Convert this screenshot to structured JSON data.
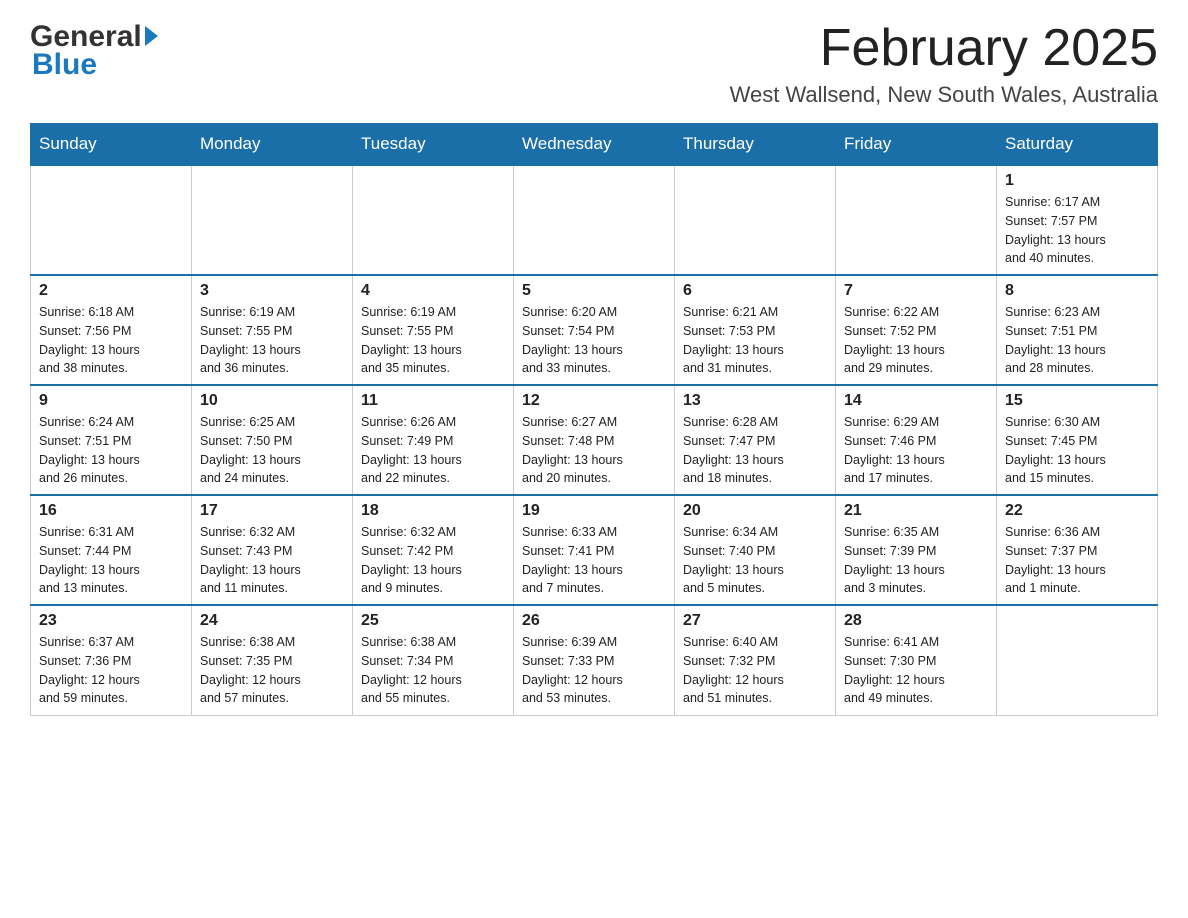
{
  "logo": {
    "general": "General",
    "blue": "Blue",
    "arrow": "▶"
  },
  "header": {
    "title": "February 2025",
    "subtitle": "West Wallsend, New South Wales, Australia"
  },
  "weekdays": [
    "Sunday",
    "Monday",
    "Tuesday",
    "Wednesday",
    "Thursday",
    "Friday",
    "Saturday"
  ],
  "weeks": [
    [
      {
        "day": "",
        "info": ""
      },
      {
        "day": "",
        "info": ""
      },
      {
        "day": "",
        "info": ""
      },
      {
        "day": "",
        "info": ""
      },
      {
        "day": "",
        "info": ""
      },
      {
        "day": "",
        "info": ""
      },
      {
        "day": "1",
        "info": "Sunrise: 6:17 AM\nSunset: 7:57 PM\nDaylight: 13 hours\nand 40 minutes."
      }
    ],
    [
      {
        "day": "2",
        "info": "Sunrise: 6:18 AM\nSunset: 7:56 PM\nDaylight: 13 hours\nand 38 minutes."
      },
      {
        "day": "3",
        "info": "Sunrise: 6:19 AM\nSunset: 7:55 PM\nDaylight: 13 hours\nand 36 minutes."
      },
      {
        "day": "4",
        "info": "Sunrise: 6:19 AM\nSunset: 7:55 PM\nDaylight: 13 hours\nand 35 minutes."
      },
      {
        "day": "5",
        "info": "Sunrise: 6:20 AM\nSunset: 7:54 PM\nDaylight: 13 hours\nand 33 minutes."
      },
      {
        "day": "6",
        "info": "Sunrise: 6:21 AM\nSunset: 7:53 PM\nDaylight: 13 hours\nand 31 minutes."
      },
      {
        "day": "7",
        "info": "Sunrise: 6:22 AM\nSunset: 7:52 PM\nDaylight: 13 hours\nand 29 minutes."
      },
      {
        "day": "8",
        "info": "Sunrise: 6:23 AM\nSunset: 7:51 PM\nDaylight: 13 hours\nand 28 minutes."
      }
    ],
    [
      {
        "day": "9",
        "info": "Sunrise: 6:24 AM\nSunset: 7:51 PM\nDaylight: 13 hours\nand 26 minutes."
      },
      {
        "day": "10",
        "info": "Sunrise: 6:25 AM\nSunset: 7:50 PM\nDaylight: 13 hours\nand 24 minutes."
      },
      {
        "day": "11",
        "info": "Sunrise: 6:26 AM\nSunset: 7:49 PM\nDaylight: 13 hours\nand 22 minutes."
      },
      {
        "day": "12",
        "info": "Sunrise: 6:27 AM\nSunset: 7:48 PM\nDaylight: 13 hours\nand 20 minutes."
      },
      {
        "day": "13",
        "info": "Sunrise: 6:28 AM\nSunset: 7:47 PM\nDaylight: 13 hours\nand 18 minutes."
      },
      {
        "day": "14",
        "info": "Sunrise: 6:29 AM\nSunset: 7:46 PM\nDaylight: 13 hours\nand 17 minutes."
      },
      {
        "day": "15",
        "info": "Sunrise: 6:30 AM\nSunset: 7:45 PM\nDaylight: 13 hours\nand 15 minutes."
      }
    ],
    [
      {
        "day": "16",
        "info": "Sunrise: 6:31 AM\nSunset: 7:44 PM\nDaylight: 13 hours\nand 13 minutes."
      },
      {
        "day": "17",
        "info": "Sunrise: 6:32 AM\nSunset: 7:43 PM\nDaylight: 13 hours\nand 11 minutes."
      },
      {
        "day": "18",
        "info": "Sunrise: 6:32 AM\nSunset: 7:42 PM\nDaylight: 13 hours\nand 9 minutes."
      },
      {
        "day": "19",
        "info": "Sunrise: 6:33 AM\nSunset: 7:41 PM\nDaylight: 13 hours\nand 7 minutes."
      },
      {
        "day": "20",
        "info": "Sunrise: 6:34 AM\nSunset: 7:40 PM\nDaylight: 13 hours\nand 5 minutes."
      },
      {
        "day": "21",
        "info": "Sunrise: 6:35 AM\nSunset: 7:39 PM\nDaylight: 13 hours\nand 3 minutes."
      },
      {
        "day": "22",
        "info": "Sunrise: 6:36 AM\nSunset: 7:37 PM\nDaylight: 13 hours\nand 1 minute."
      }
    ],
    [
      {
        "day": "23",
        "info": "Sunrise: 6:37 AM\nSunset: 7:36 PM\nDaylight: 12 hours\nand 59 minutes."
      },
      {
        "day": "24",
        "info": "Sunrise: 6:38 AM\nSunset: 7:35 PM\nDaylight: 12 hours\nand 57 minutes."
      },
      {
        "day": "25",
        "info": "Sunrise: 6:38 AM\nSunset: 7:34 PM\nDaylight: 12 hours\nand 55 minutes."
      },
      {
        "day": "26",
        "info": "Sunrise: 6:39 AM\nSunset: 7:33 PM\nDaylight: 12 hours\nand 53 minutes."
      },
      {
        "day": "27",
        "info": "Sunrise: 6:40 AM\nSunset: 7:32 PM\nDaylight: 12 hours\nand 51 minutes."
      },
      {
        "day": "28",
        "info": "Sunrise: 6:41 AM\nSunset: 7:30 PM\nDaylight: 12 hours\nand 49 minutes."
      },
      {
        "day": "",
        "info": ""
      }
    ]
  ]
}
